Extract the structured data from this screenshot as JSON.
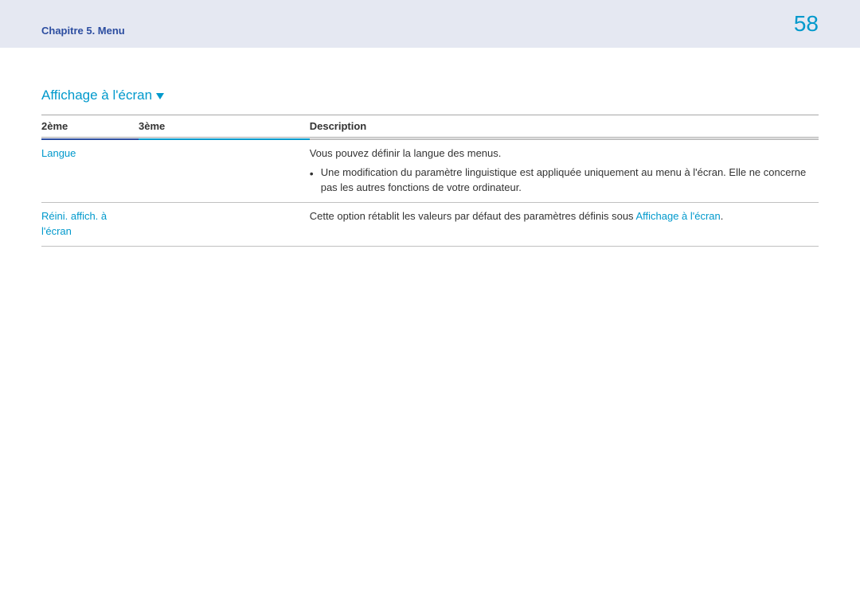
{
  "header": {
    "chapter_label": "Chapitre 5. Menu",
    "page_number": "58"
  },
  "section": {
    "title": "Affichage à l'écran"
  },
  "table": {
    "headers": {
      "col1": "2ème",
      "col2": "3ème",
      "col3": "Description"
    },
    "rows": [
      {
        "col1": "Langue",
        "col2": "",
        "desc_main": "Vous pouvez définir la langue des menus.",
        "bullets": [
          "Une modification du paramètre linguistique est appliquée uniquement au menu à l'écran. Elle ne concerne pas les autres fonctions de votre ordinateur."
        ]
      },
      {
        "col1": "Réini. affich. à l'écran",
        "col2": "",
        "desc_prefix": "Cette option rétablit les valeurs par défaut des paramètres définis sous ",
        "desc_link": "Affichage à l'écran",
        "desc_suffix": "."
      }
    ]
  }
}
